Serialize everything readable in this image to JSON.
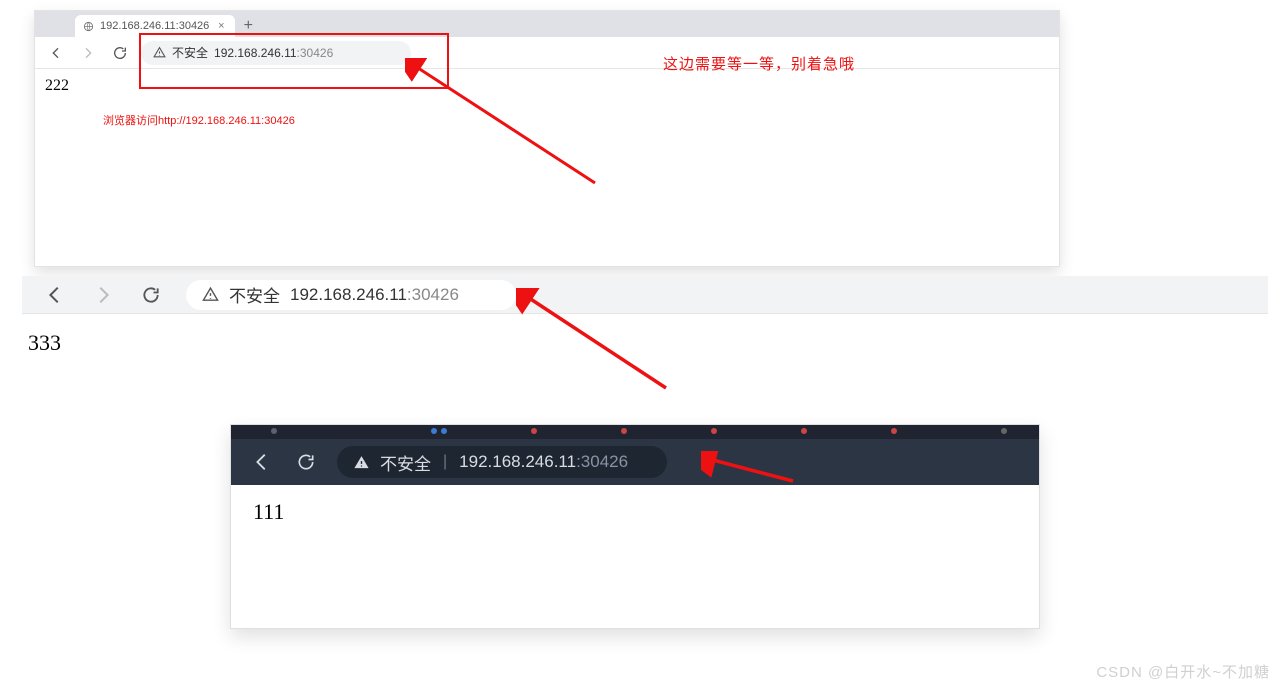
{
  "shot1": {
    "tab_title": "192.168.246.11:30426",
    "insecure_label": "不安全",
    "url_host": "192.168.246.11",
    "url_port": ":30426",
    "page_text": "222",
    "caption": "浏览器访问http://192.168.246.11:30426",
    "note": "这边需要等一等，别着急哦",
    "close_glyph": "×",
    "plus_glyph": "+"
  },
  "shot2": {
    "insecure_label": "不安全",
    "url_host": "192.168.246.11",
    "url_port": ":30426",
    "page_text": "333"
  },
  "shot3": {
    "insecure_label": "不安全",
    "url_host": "192.168.246.11",
    "url_port": ":30426",
    "page_text": "111"
  },
  "watermark": "CSDN @白开水~不加糖"
}
